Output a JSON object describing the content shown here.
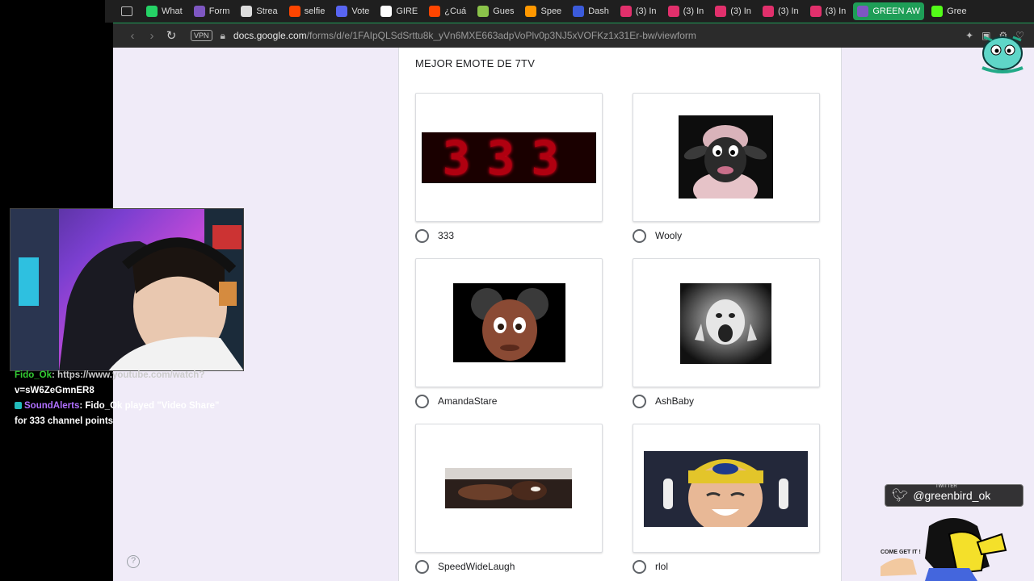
{
  "bookmarks": [
    {
      "label": "What",
      "color": "#25d366",
      "active": false
    },
    {
      "label": "Form",
      "color": "#7e57c2",
      "active": false
    },
    {
      "label": "Strea",
      "color": "#dddddd",
      "active": false
    },
    {
      "label": "selfie",
      "color": "#ff4500",
      "active": false
    },
    {
      "label": "Vote",
      "color": "#5865f2",
      "active": false
    },
    {
      "label": "GIRE",
      "color": "#ffffff",
      "active": false
    },
    {
      "label": "¿Cuá",
      "color": "#ff4500",
      "active": false
    },
    {
      "label": "Gues",
      "color": "#8bc34a",
      "active": false
    },
    {
      "label": "Spee",
      "color": "#ff9800",
      "active": false
    },
    {
      "label": "Dash",
      "color": "#3b5bdb",
      "active": false
    },
    {
      "label": "(3) In",
      "color": "#e1306c",
      "active": false
    },
    {
      "label": "(3) In",
      "color": "#e1306c",
      "active": false
    },
    {
      "label": "(3) In",
      "color": "#e1306c",
      "active": false
    },
    {
      "label": "(3) In",
      "color": "#e1306c",
      "active": false
    },
    {
      "label": "(3) In",
      "color": "#e1306c",
      "active": false
    },
    {
      "label": "GREEN AW",
      "color": "#7e57c2",
      "active": true
    },
    {
      "label": "Gree",
      "color": "#53fc18",
      "active": false
    }
  ],
  "urlbar": {
    "vpn": "VPN",
    "domain": "docs.google.com",
    "path": "/forms/d/e/1FAIpQLSdSrttu8k_yVn6MXE663adpVoPlv0p3NJ5xVOFKz1x31Er-bw/viewform"
  },
  "form": {
    "question_title": "MEJOR EMOTE DE 7TV",
    "options": [
      {
        "label": "333"
      },
      {
        "label": "Wooly"
      },
      {
        "label": "AmandaStare"
      },
      {
        "label": "AshBaby"
      },
      {
        "label": "SpeedWideLaugh"
      },
      {
        "label": "rlol"
      }
    ],
    "emote_333_text": "333"
  },
  "chat": {
    "line1_user": "Fido_Ok",
    "line1_text": ": https://www.youtube.com/watch?",
    "line2_text": "v=sW6ZeGmnER8",
    "line3_user": "SoundAlerts",
    "line3_text": ": Fido_Ok played \"Video Share\"",
    "line4_text": "for 333 channel points"
  },
  "overlay": {
    "twitter_small": "TWITTER",
    "twitter_handle": "@greenbird_ok",
    "come_get_it": "COME GET IT !"
  },
  "colors": {
    "page_bg": "#f0ebf8",
    "accent_green": "#1e9e57"
  }
}
